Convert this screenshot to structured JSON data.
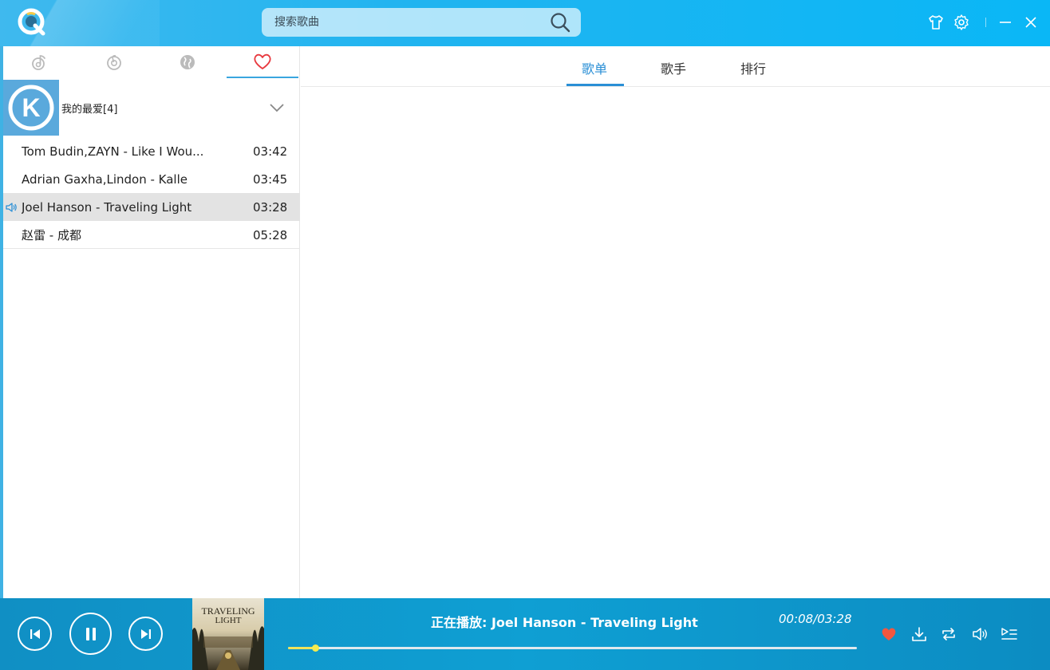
{
  "search": {
    "placeholder": "搜索歌曲"
  },
  "left_tabs": [
    {
      "name": "music-note-icon"
    },
    {
      "name": "netease-icon"
    },
    {
      "name": "globe-icon"
    },
    {
      "name": "heart-icon",
      "active": true
    }
  ],
  "playlist": {
    "title": "我的最爱[4]",
    "logo_letter": "K",
    "songs": [
      {
        "title": "Tom Budin,ZAYN - Like I Wou...",
        "duration": "03:42"
      },
      {
        "title": "Adrian Gaxha,Lindon - Kalle",
        "duration": "03:45"
      },
      {
        "title": "Joel Hanson - Traveling Light",
        "duration": "03:28",
        "playing": true
      },
      {
        "title": "赵雷 - 成都",
        "duration": "05:28"
      }
    ]
  },
  "right_tabs": [
    {
      "label": "歌单",
      "active": true
    },
    {
      "label": "歌手"
    },
    {
      "label": "排行"
    }
  ],
  "player": {
    "now_playing": "正在播放: Joel Hanson - Traveling Light",
    "time": "00:08/03:28",
    "progress": 0.047,
    "album_title_line1": "TRAVELING",
    "album_title_line2": "LIGHT"
  },
  "colors": {
    "accent": "#2a8fd6",
    "header": "#0ab7f6",
    "player_bg": "#0f9fd3",
    "favorite": "#f2573f",
    "progress": "#f0e35a"
  }
}
